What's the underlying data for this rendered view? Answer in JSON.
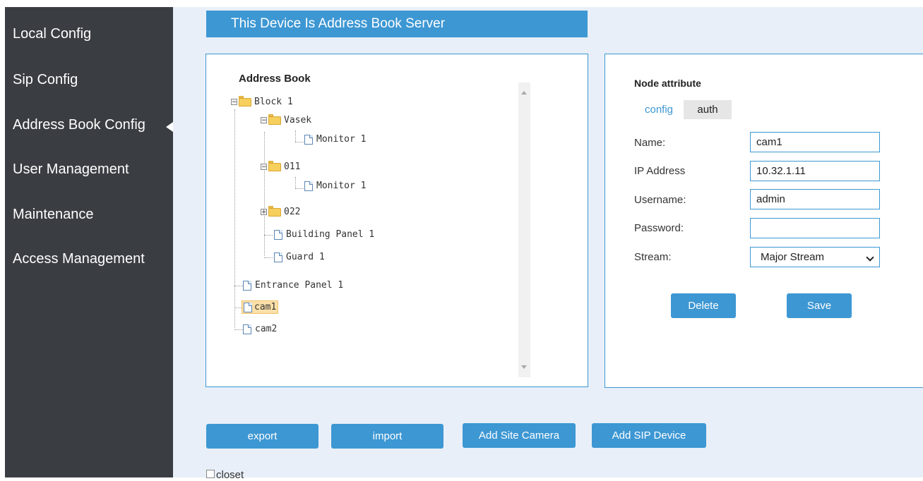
{
  "sidebar": {
    "items": [
      {
        "label": "Local Config"
      },
      {
        "label": "Sip Config"
      },
      {
        "label": "Address Book Config"
      },
      {
        "label": "User Management"
      },
      {
        "label": "Maintenance"
      },
      {
        "label": "Access Management"
      }
    ],
    "active_index": 2
  },
  "banner": {
    "title": "This Device Is Address Book Server"
  },
  "address_book": {
    "title": "Address Book",
    "nodes": {
      "block1": "Block 1",
      "vasek": "Vasek",
      "vasek_monitor": "Monitor 1",
      "f011": "011",
      "f011_monitor": "Monitor 1",
      "f022": "022",
      "building_panel": "Building Panel 1",
      "guard": "Guard 1",
      "entrance_panel": "Entrance Panel 1",
      "cam1": "cam1",
      "cam2": "cam2"
    },
    "selected": "cam1"
  },
  "node_attribute": {
    "title": "Node attribute",
    "tabs": [
      {
        "label": "config",
        "active": true
      },
      {
        "label": "auth",
        "active": false
      }
    ],
    "fields": {
      "name": {
        "label": "Name:",
        "value": "cam1"
      },
      "ip": {
        "label": "IP Address",
        "value": "10.32.1.11"
      },
      "username": {
        "label": "Username:",
        "value": "admin"
      },
      "password": {
        "label": "Password:",
        "value": ""
      },
      "stream": {
        "label": "Stream:",
        "value": "Major Stream"
      }
    },
    "delete_label": "Delete",
    "save_label": "Save"
  },
  "actions": {
    "export": "export",
    "import": "import",
    "add_site_camera": "Add Site Camera",
    "add_sip_device": "Add SIP Device"
  },
  "closet": {
    "label": "closet",
    "checked": false
  },
  "colors": {
    "sidebar_bg": "#3a3d42",
    "accent": "#3d97d3",
    "main_bg": "#e8eff8",
    "selected_node": "#fbe0a9"
  }
}
